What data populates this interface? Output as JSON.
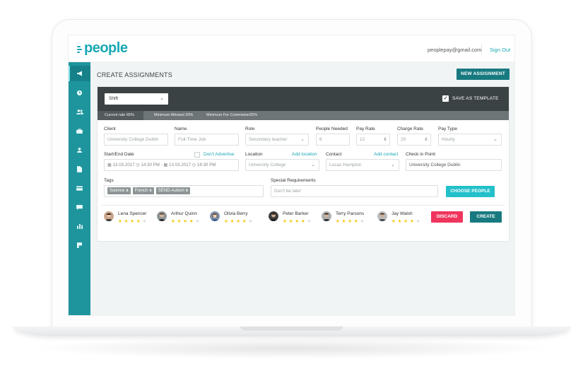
{
  "app": {
    "logo_text": "people",
    "brand_color": "#1aa8b4"
  },
  "header": {
    "user_email": "peoplepay@gmail.com",
    "sign_out": "Sign Out"
  },
  "sidebar": {
    "color": "#1e959d",
    "items": [
      {
        "icon": "megaphone-icon",
        "active": true
      },
      {
        "icon": "clock-icon"
      },
      {
        "icon": "users-icon"
      },
      {
        "icon": "briefcase-icon"
      },
      {
        "icon": "user-icon"
      },
      {
        "icon": "document-icon"
      },
      {
        "icon": "credit-card-icon"
      },
      {
        "icon": "chat-icon"
      },
      {
        "icon": "bar-chart-icon"
      },
      {
        "icon": "flag-icon"
      }
    ]
  },
  "page": {
    "title": "CREATE ASSIGNMENTS",
    "new_button": "NEW ASSIGNMENT"
  },
  "form": {
    "shift_select": "Shift",
    "save_template": "SAVE AS TEMPLATE",
    "save_template_checked": true,
    "rates": {
      "current": "Current rate 65%",
      "current_value": 0.65,
      "min_allowed": "Minimum Allowed 20%",
      "min_commission": "Minimum For Commision25%"
    },
    "client": {
      "label": "Client",
      "placeholder": "University College Dublin"
    },
    "name": {
      "label": "Name",
      "placeholder": "Full-Time Job"
    },
    "role": {
      "label": "Role",
      "value": "Secondary teacher"
    },
    "people_needed": {
      "label": "People Needed",
      "value": "6"
    },
    "pay_rate": {
      "label": "Pay Rate",
      "value": "12",
      "suffix": "€"
    },
    "charge_rate": {
      "label": "Charge Rate",
      "value": "20",
      "suffix": "€"
    },
    "pay_type": {
      "label": "Pay Type",
      "value": "Hourly"
    },
    "start_end": {
      "label": "Start/End Date",
      "start_date": "13.03.2017",
      "start_time": "14:30 PM",
      "end_date": "13.03.2017",
      "end_time": "16:30 PM",
      "separator": "-"
    },
    "dont_advertise": "Don't Advertise",
    "location": {
      "label": "Location",
      "add_link": "Add location",
      "value": "University College"
    },
    "contact": {
      "label": "Contact",
      "add_link": "Add contact",
      "value": "Lucas Hampton"
    },
    "checkin": {
      "label": "Check in Point",
      "value": "University College Dublin"
    },
    "tags": {
      "label": "Tags",
      "items": [
        "Science",
        "French",
        "SEND-Autism"
      ],
      "remove": "x"
    },
    "special": {
      "label": "Special Requirements",
      "placeholder": "Don't be late!"
    },
    "choose_people": "CHOOSE PEOPLE"
  },
  "people": [
    {
      "name": "Lena Spencer",
      "rating": 4
    },
    {
      "name": "Arthur Quinn",
      "rating": 4
    },
    {
      "name": "Olivia Berry",
      "rating": 4
    },
    {
      "name": "Peter Barker",
      "rating": 4
    },
    {
      "name": "Terry Parsons",
      "rating": 4
    },
    {
      "name": "Jay Walsh",
      "rating": 4
    }
  ],
  "actions": {
    "discard": "DISCARD",
    "create": "CREATE"
  }
}
